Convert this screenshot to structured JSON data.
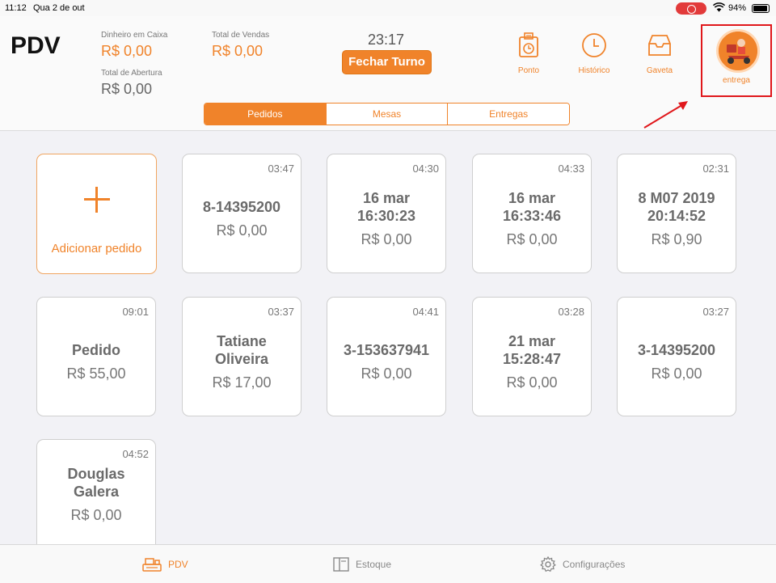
{
  "status_bar": {
    "time": "11:12",
    "date": "Qua 2 de out",
    "battery": "94%"
  },
  "header": {
    "title": "PDV",
    "cash_label": "Dinheiro em Caixa",
    "cash_value": "R$ 0,00",
    "sales_label": "Total de Vendas",
    "sales_value": "R$ 0,00",
    "opening_label": "Total de Abertura",
    "opening_value": "R$ 0,00",
    "clock": "23:17",
    "close_shift": "Fechar Turno",
    "tools": [
      {
        "label": "Ponto",
        "icon": "time-clock-icon"
      },
      {
        "label": "Histórico",
        "icon": "clock-icon"
      },
      {
        "label": "Gaveta",
        "icon": "drawer-icon"
      }
    ],
    "delivery_label": "entrega"
  },
  "tabs": [
    "Pedidos",
    "Mesas",
    "Entregas"
  ],
  "active_tab": "Pedidos",
  "add_order": "Adicionar pedido",
  "orders": [
    {
      "time": "03:47",
      "name": "8-14395200",
      "total": "R$ 0,00"
    },
    {
      "time": "04:30",
      "name": "16 mar\n16:30:23",
      "total": "R$ 0,00"
    },
    {
      "time": "04:33",
      "name": "16 mar\n16:33:46",
      "total": "R$ 0,00"
    },
    {
      "time": "02:31",
      "name": "8 M07 2019\n20:14:52",
      "total": "R$ 0,90"
    },
    {
      "time": "09:01",
      "name": "Pedido",
      "total": "R$ 55,00"
    },
    {
      "time": "03:37",
      "name": "Tatiane\nOliveira",
      "total": "R$ 17,00"
    },
    {
      "time": "04:41",
      "name": "3-153637941",
      "total": "R$ 0,00"
    },
    {
      "time": "03:28",
      "name": "21 mar\n15:28:47",
      "total": "R$ 0,00"
    },
    {
      "time": "03:27",
      "name": "3-14395200",
      "total": "R$ 0,00"
    },
    {
      "time": "04:52",
      "name": "Douglas\nGalera",
      "total": "R$ 0,00"
    }
  ],
  "bottom_tabs": [
    {
      "label": "PDV",
      "icon": "register-icon"
    },
    {
      "label": "Estoque",
      "icon": "stock-icon"
    },
    {
      "label": "Configurações",
      "icon": "gear-icon"
    }
  ],
  "colors": {
    "accent": "#f0832a",
    "highlight": "#e0171b"
  }
}
